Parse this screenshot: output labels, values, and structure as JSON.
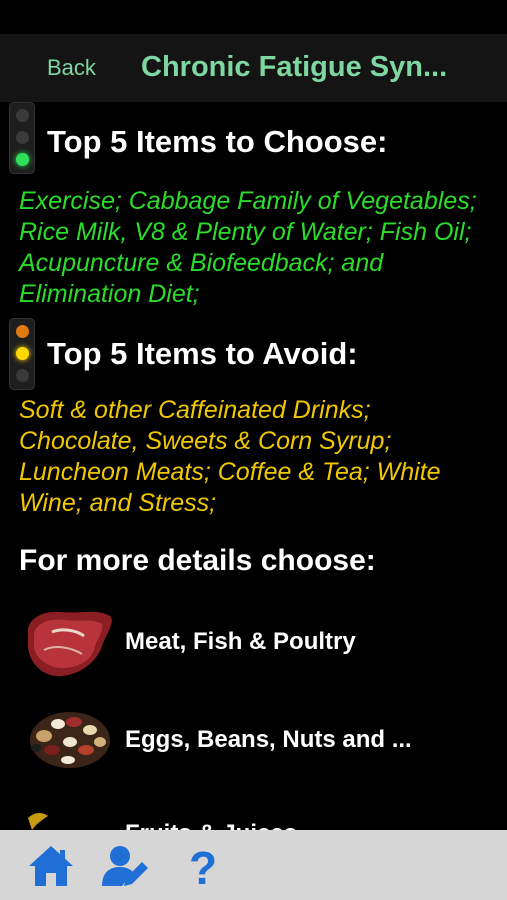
{
  "nav": {
    "back_label": "Back",
    "title": "Chronic Fatigue Syn..."
  },
  "choose": {
    "heading": "Top 5 Items to Choose:",
    "text": "Exercise; Cabbage Family of Vegetables; Rice Milk, V8 & Plenty of Water; Fish Oil; Acupuncture & Biofeedback; and Elimination Diet;",
    "color": "#2bdc2b"
  },
  "avoid": {
    "heading": "Top 5 Items to Avoid:",
    "text": "Soft & other Caffeinated Drinks; Chocolate, Sweets & Corn Syrup; Luncheon Meats; Coffee & Tea; White Wine; and Stress;",
    "color": "#f0c800"
  },
  "details": {
    "heading": "For more details choose:",
    "categories": [
      {
        "label": "Meat, Fish & Poultry",
        "icon": "meat-steak-icon"
      },
      {
        "label": "Eggs, Beans, Nuts and ...",
        "icon": "beans-nuts-icon"
      },
      {
        "label": "Fruits & Juices",
        "icon": "fruit-banana-icon"
      }
    ]
  },
  "tabbar": {
    "accent": "#1f6fd6",
    "items": [
      {
        "icon": "home-icon"
      },
      {
        "icon": "user-edit-icon"
      },
      {
        "icon": "help-question-icon"
      }
    ]
  }
}
